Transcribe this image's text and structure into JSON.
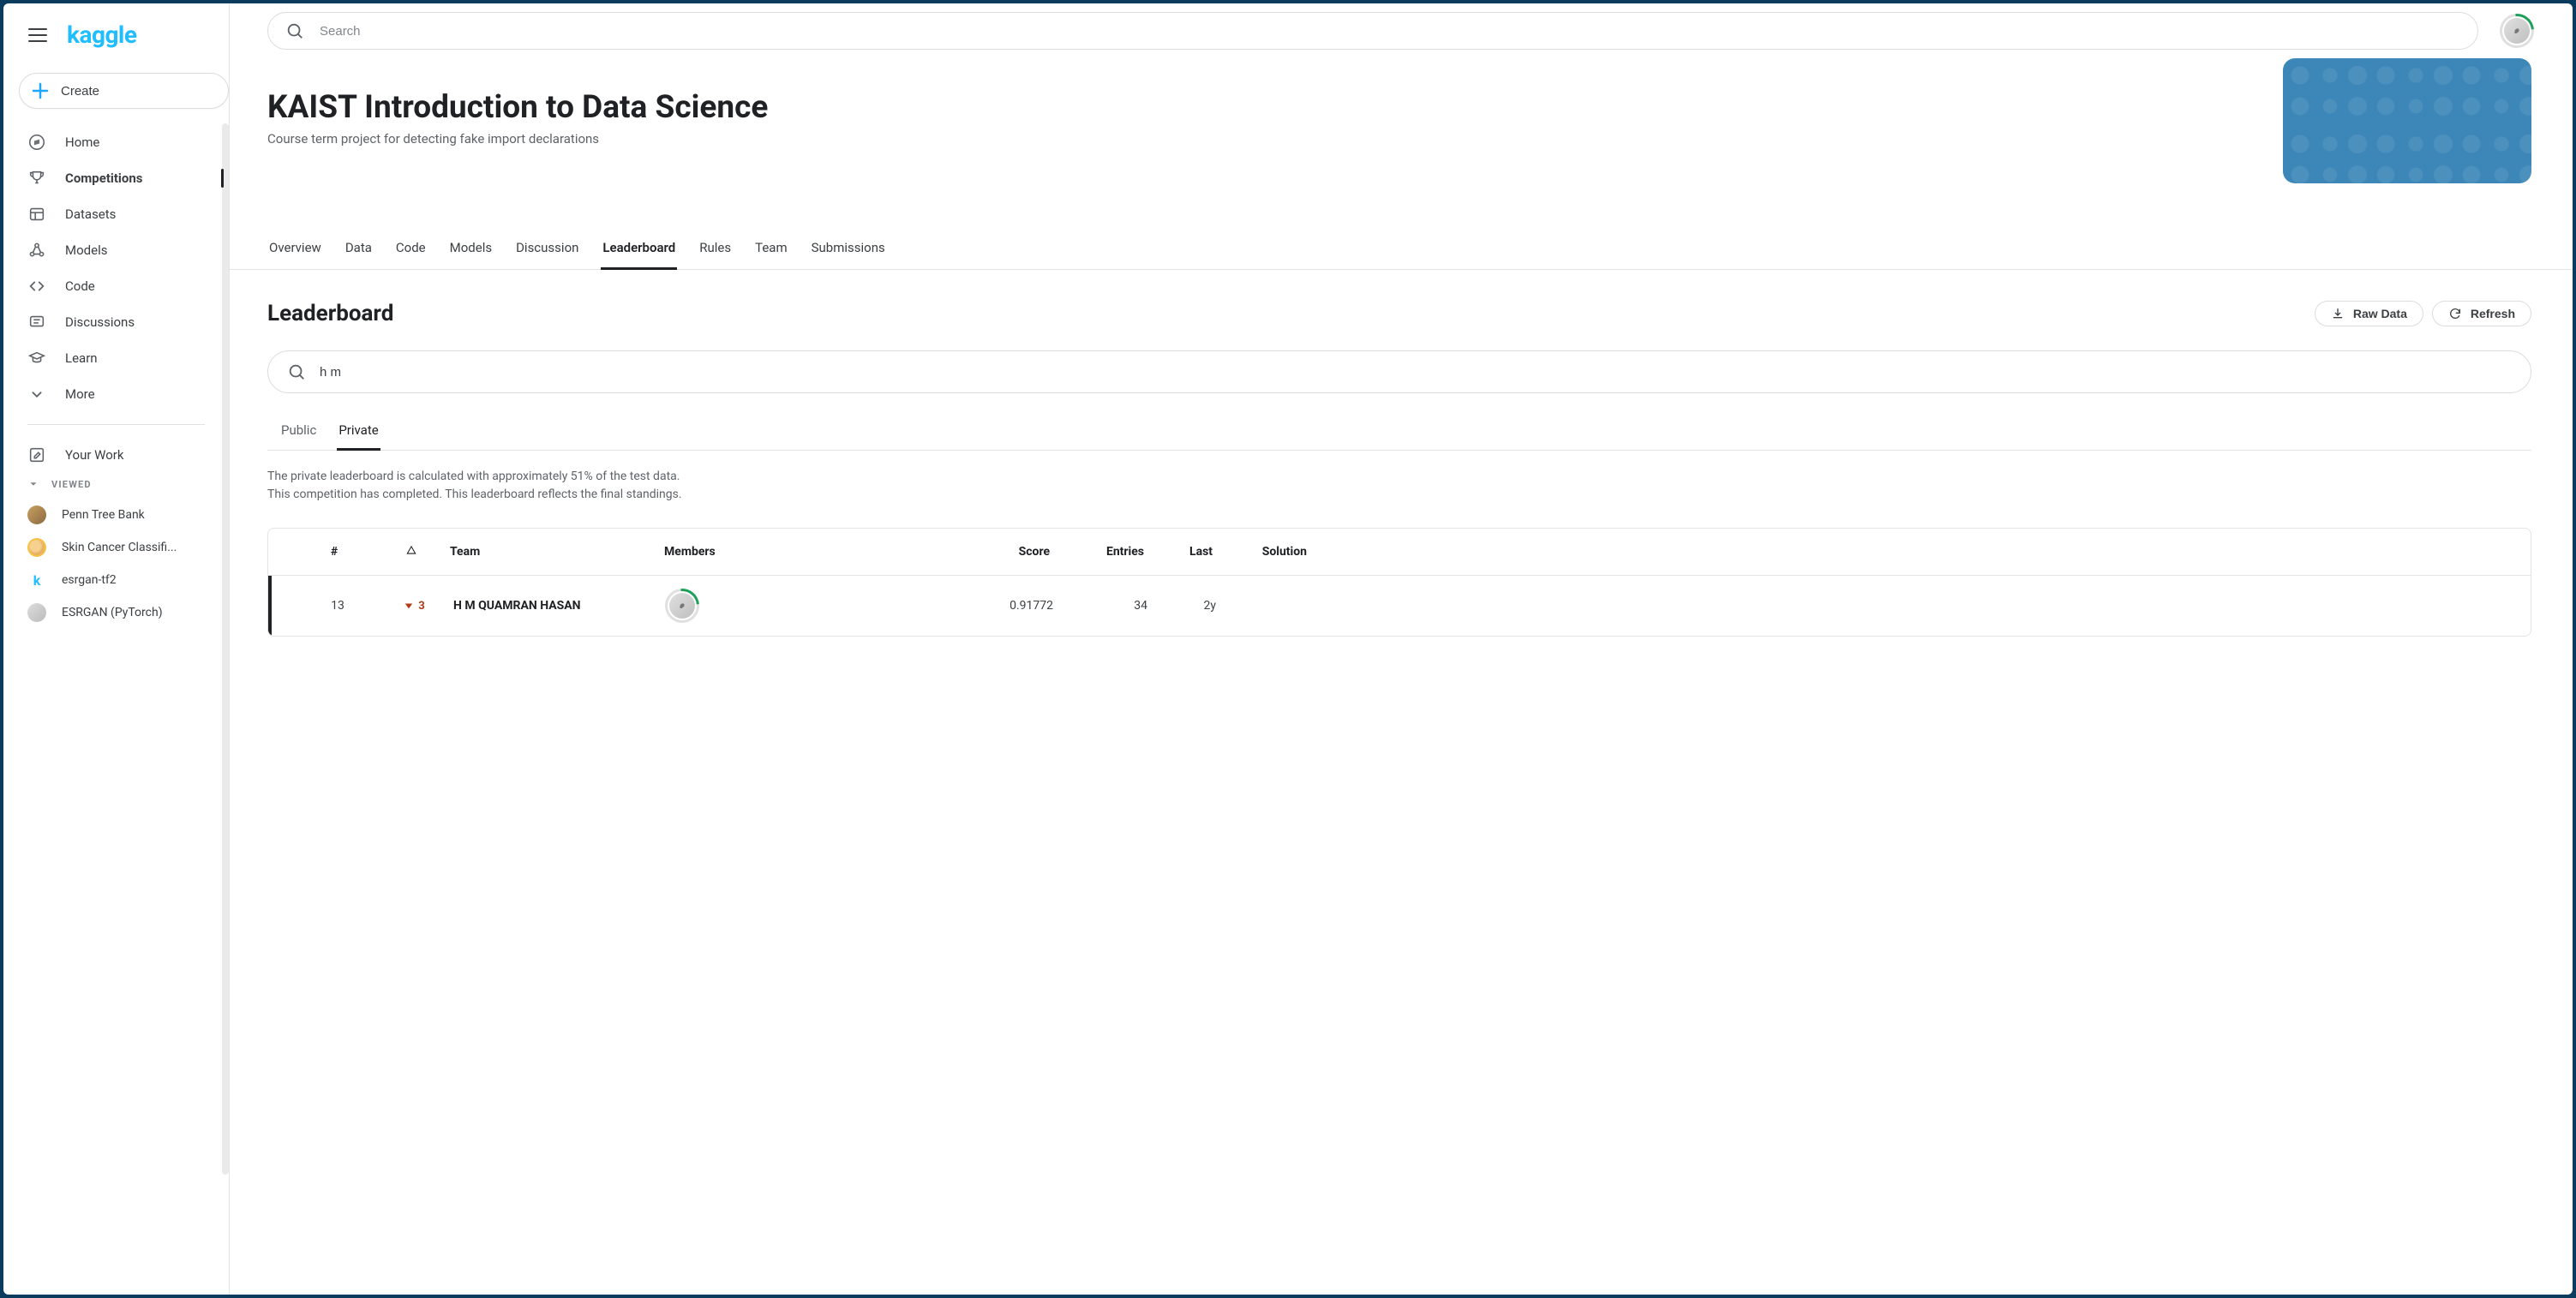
{
  "brand": {
    "logo_text": "kaggle"
  },
  "sidebar": {
    "create_label": "Create",
    "items": [
      {
        "label": "Home"
      },
      {
        "label": "Competitions"
      },
      {
        "label": "Datasets"
      },
      {
        "label": "Models"
      },
      {
        "label": "Code"
      },
      {
        "label": "Discussions"
      },
      {
        "label": "Learn"
      },
      {
        "label": "More"
      }
    ],
    "your_work_label": "Your Work",
    "viewed_header": "VIEWED",
    "viewed": [
      {
        "label": "Penn Tree Bank"
      },
      {
        "label": "Skin Cancer Classifi..."
      },
      {
        "label": "esrgan-tf2"
      },
      {
        "label": "ESRGAN (PyTorch)"
      }
    ]
  },
  "topbar": {
    "search_placeholder": "Search"
  },
  "competition": {
    "title": "KAIST Introduction to Data Science",
    "subtitle": "Course term project for detecting fake import declarations"
  },
  "tabs": [
    {
      "label": "Overview"
    },
    {
      "label": "Data"
    },
    {
      "label": "Code"
    },
    {
      "label": "Models"
    },
    {
      "label": "Discussion"
    },
    {
      "label": "Leaderboard"
    },
    {
      "label": "Rules"
    },
    {
      "label": "Team"
    },
    {
      "label": "Submissions"
    }
  ],
  "leaderboard": {
    "title": "Leaderboard",
    "actions": {
      "raw_data": "Raw Data",
      "refresh": "Refresh"
    },
    "search_value": "h m",
    "sub_tabs": {
      "public": "Public",
      "private": "Private"
    },
    "note_line1": "The private leaderboard is calculated with approximately 51% of the test data.",
    "note_line2": "This competition has completed. This leaderboard reflects the final standings.",
    "columns": {
      "rank": "#",
      "delta": "△",
      "team": "Team",
      "members": "Members",
      "score": "Score",
      "entries": "Entries",
      "last": "Last",
      "solution": "Solution"
    },
    "rows": [
      {
        "rank": "13",
        "delta": "3",
        "team": "H M QUAMRAN HASAN",
        "score": "0.91772",
        "entries": "34",
        "last": "2y"
      }
    ]
  }
}
